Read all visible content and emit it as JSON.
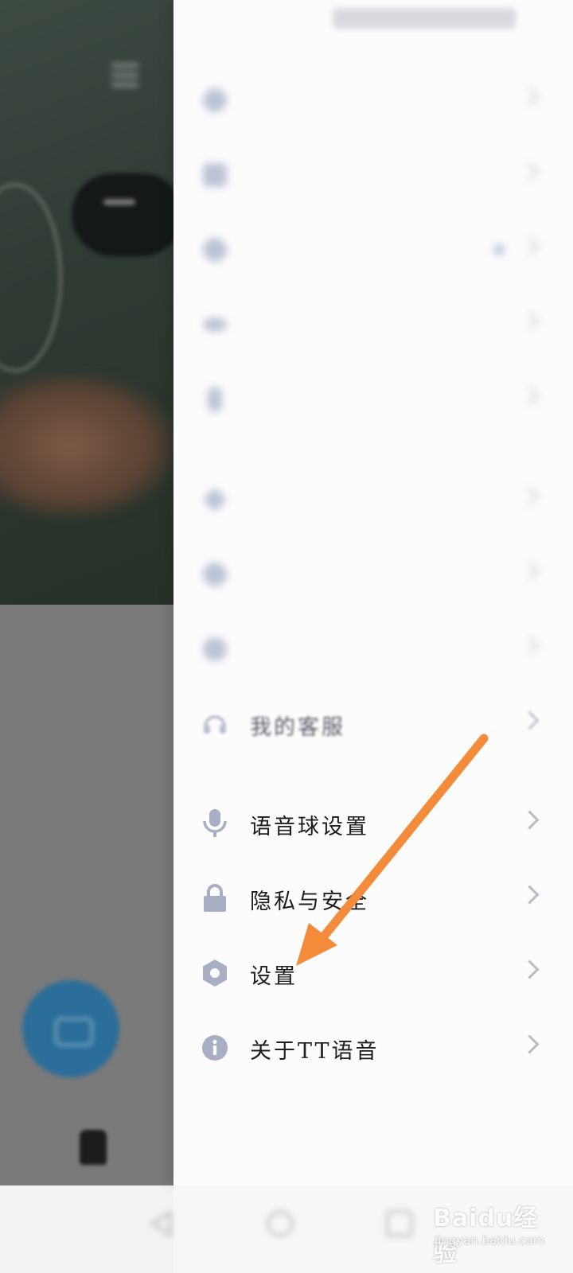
{
  "colors": {
    "drawer_bg": "#fcfcfd",
    "icon_gray": "#a8afc4",
    "text_dark": "#1d1d1f",
    "chevron": "#b9bcc6",
    "arrow_orange": "#f38b3a"
  },
  "drawer": {
    "items": [
      {
        "label": "",
        "icon": "blurred-icon"
      },
      {
        "label": "",
        "icon": "blurred-icon"
      },
      {
        "label": "",
        "icon": "blurred-icon"
      },
      {
        "label": "",
        "icon": "blurred-icon"
      },
      {
        "label": "",
        "icon": "blurred-icon"
      },
      {
        "label": "",
        "icon": "blurred-icon"
      },
      {
        "label": "",
        "icon": "blurred-icon"
      },
      {
        "label": "",
        "icon": "blurred-icon"
      },
      {
        "label": "我的客服",
        "icon": "headset-icon"
      },
      {
        "label": "语音球设置",
        "icon": "microphone-icon"
      },
      {
        "label": "隐私与安全",
        "icon": "lock-icon"
      },
      {
        "label": "设置",
        "icon": "gear-hexagon-icon"
      },
      {
        "label": "关于TT语音",
        "icon": "info-icon"
      }
    ]
  },
  "watermark": {
    "brand": "Baidu经验",
    "url": "jingyan.baidu.com"
  }
}
